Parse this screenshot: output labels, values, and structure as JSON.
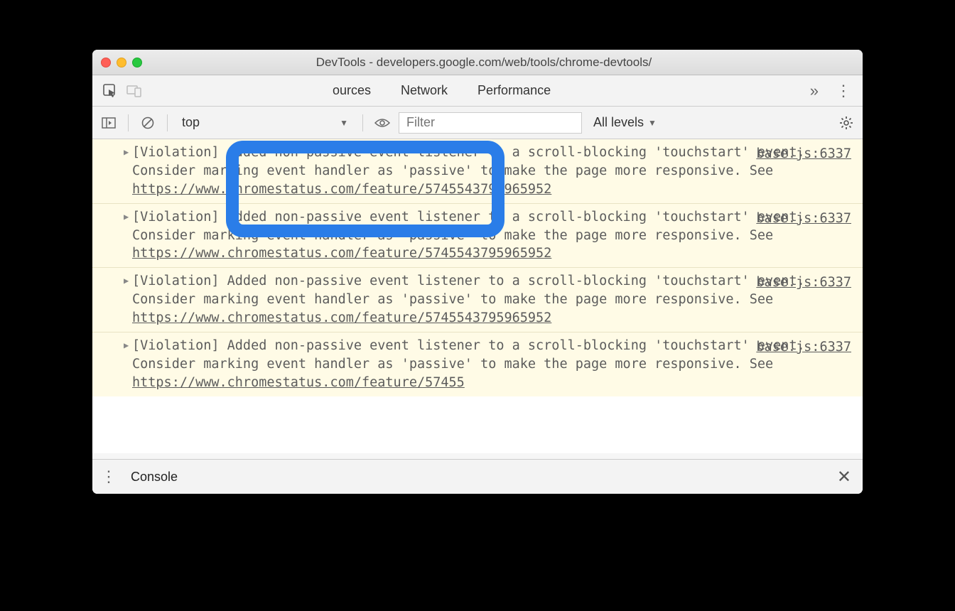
{
  "window": {
    "title": "DevTools - developers.google.com/web/tools/chrome-devtools/"
  },
  "tabs": {
    "sources": "ources",
    "network": "Network",
    "performance": "Performance"
  },
  "toolbar": {
    "context": "top",
    "filter_placeholder": "Filter",
    "levels": "All levels"
  },
  "messages": [
    {
      "text": "[Violation] Added non-passive event listener to a scroll-blocking 'touchstart' event. Consider marking event handler as 'passive' to make the page more responsive. See ",
      "link": "https://www.chromestatus.com/feature/5745543795965952",
      "source": "base.js:6337"
    },
    {
      "text": "[Violation] Added non-passive event listener to a scroll-blocking 'touchstart' event. Consider marking event handler as 'passive' to make the page more responsive. See ",
      "link": "https://www.chromestatus.com/feature/5745543795965952",
      "source": "base.js:6337"
    },
    {
      "text": "[Violation] Added non-passive event listener to a scroll-blocking 'touchstart' event. Consider marking event handler as 'passive' to make the page more responsive. See ",
      "link": "https://www.chromestatus.com/feature/5745543795965952",
      "source": "base.js:6337"
    },
    {
      "text": "[Violation] Added non-passive event listener to a scroll-blocking 'touchstart' event. Consider marking event handler as 'passive' to make the page more responsive. See ",
      "link": "https://www.chromestatus.com/feature/57455",
      "source": "base.js:6337"
    }
  ],
  "drawer": {
    "tab": "Console"
  }
}
